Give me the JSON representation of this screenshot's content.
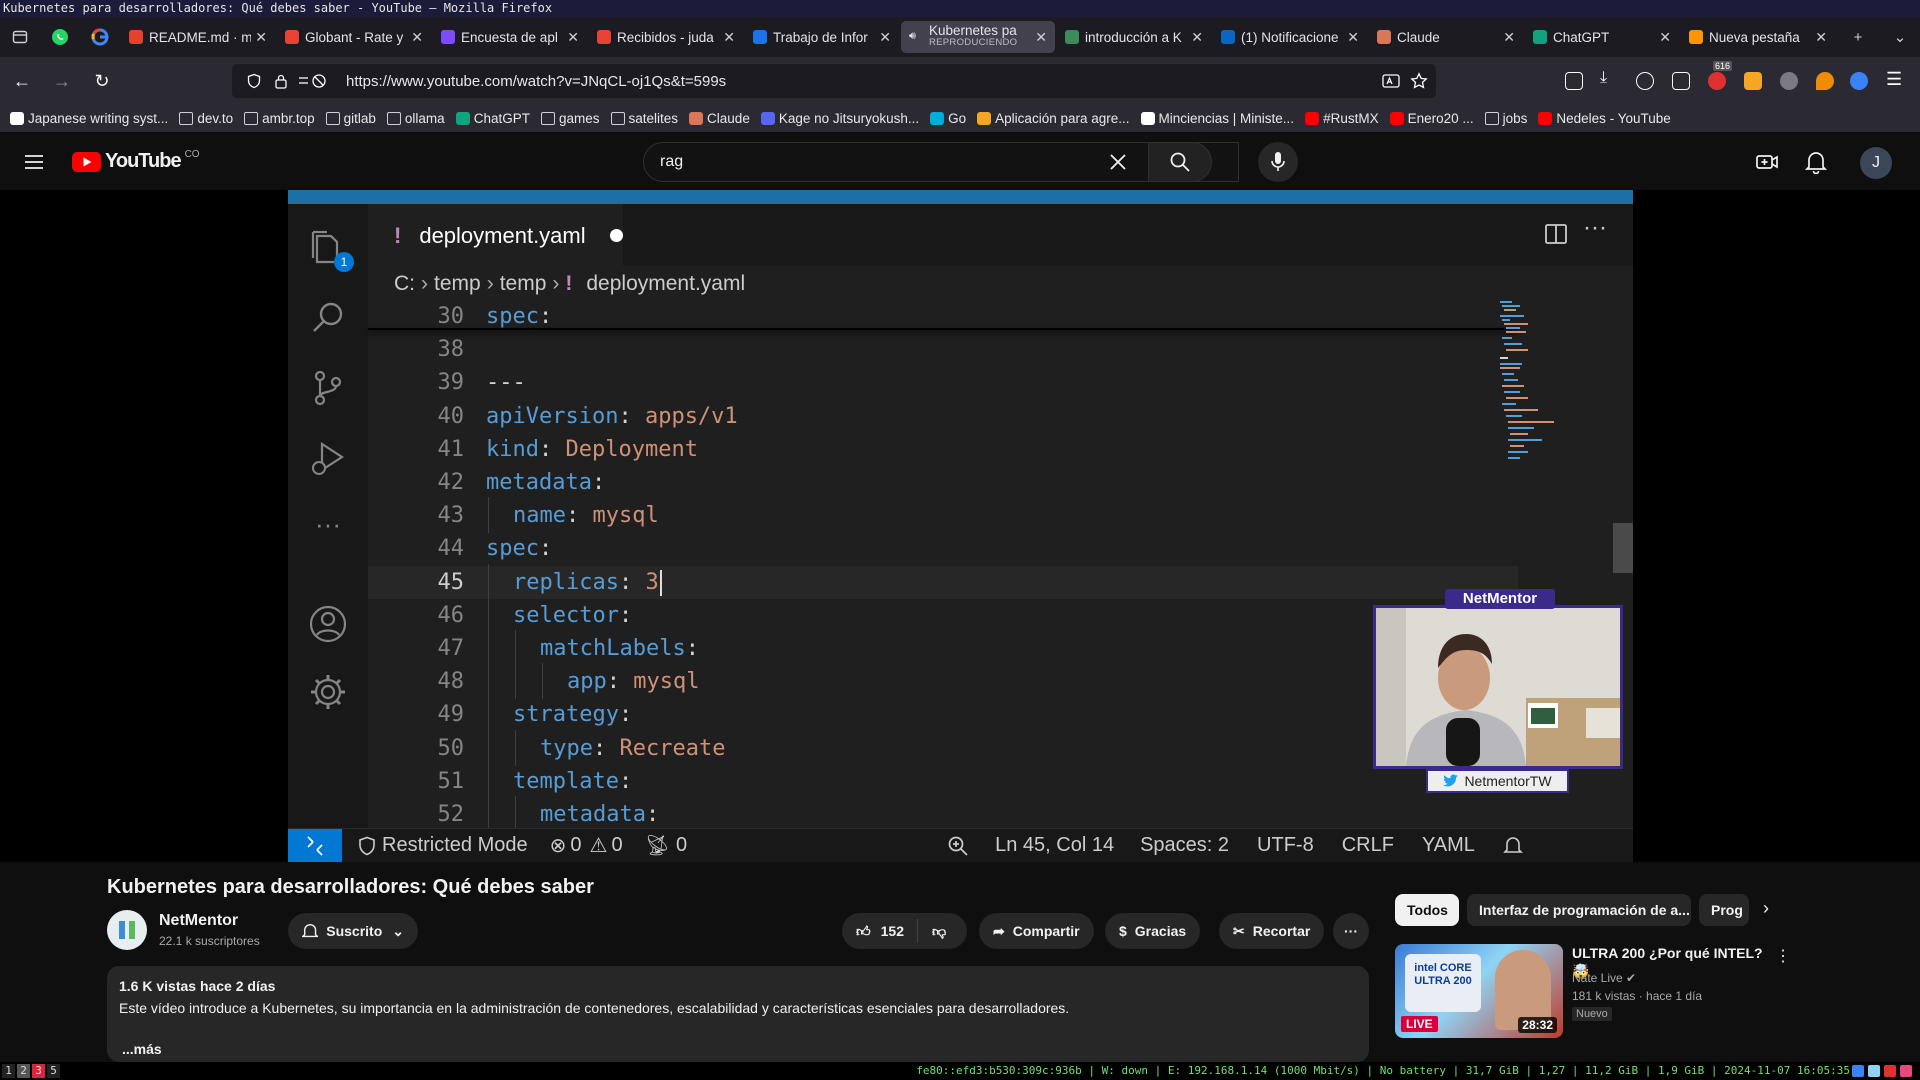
{
  "window": {
    "title": "Kubernetes para desarrolladores: Qué debes saber - YouTube — Mozilla Firefox"
  },
  "tabs": [
    {
      "title": "README.md · ma",
      "color": "#e2432a"
    },
    {
      "title": "Globant - Rate y",
      "color": "#ea4335"
    },
    {
      "title": "Encuesta de apl",
      "color": "#7c4dff"
    },
    {
      "title": "Recibidos - juda",
      "color": "#ea4335"
    },
    {
      "title": "Trabajo de Infor",
      "color": "#1a73e8"
    },
    {
      "title": "Kubernetes pa",
      "sub": "REPRODUCIENDO",
      "color": "#cccccc",
      "active": true
    },
    {
      "title": "introducción a K",
      "color": "#3c8b5b"
    },
    {
      "title": "(1) Notificacione",
      "color": "#0a66c2"
    },
    {
      "title": "Claude",
      "color": "#d97757"
    },
    {
      "title": "ChatGPT",
      "color": "#10a37f"
    },
    {
      "title": "Nueva pestaña",
      "color": "#ff9500"
    }
  ],
  "nav": {
    "url": "https://www.youtube.com/watch?v=JNqCL-oj1Qs&t=599s",
    "badge_count": "616"
  },
  "bookmarks": [
    {
      "label": "Japanese writing syst...",
      "fav": true,
      "color": "#ffffff"
    },
    {
      "label": "dev.to",
      "fav": false
    },
    {
      "label": "ambr.top",
      "fav": false
    },
    {
      "label": "gitlab",
      "fav": false
    },
    {
      "label": "ollama",
      "fav": false
    },
    {
      "label": "ChatGPT",
      "fav": true,
      "color": "#10a37f"
    },
    {
      "label": "games",
      "fav": false
    },
    {
      "label": "satelites",
      "fav": false
    },
    {
      "label": "Claude",
      "fav": true,
      "color": "#d97757"
    },
    {
      "label": "Kage no Jitsuryokush...",
      "fav": true,
      "color": "#5865f2"
    },
    {
      "label": "Go",
      "fav": true,
      "color": "#00add8"
    },
    {
      "label": "Aplicación para agre...",
      "fav": true,
      "color": "#f5a623"
    },
    {
      "label": "Minciencias | Ministe...",
      "fav": true,
      "color": "#ffffff"
    },
    {
      "label": "#RustMX",
      "fav": true,
      "color": "#ff0000"
    },
    {
      "label": "Enero20 ...",
      "fav": true,
      "color": "#ff0000"
    },
    {
      "label": "jobs",
      "fav": false
    },
    {
      "label": "Nedeles - YouTube",
      "fav": true,
      "color": "#ff0000"
    }
  ],
  "youtube": {
    "logo_text": "YouTube",
    "country": "CO",
    "search_value": "rag",
    "avatar_letter": "J"
  },
  "vscode": {
    "tab_name": "deployment.yaml",
    "breadcrumb": [
      "C:",
      "temp",
      "temp",
      "deployment.yaml"
    ],
    "lines": [
      {
        "n": "30",
        "indent": 0,
        "key": "spec",
        "sep": ":",
        "val": ""
      },
      {
        "n": "38",
        "indent": 0,
        "key": "",
        "sep": "",
        "val": ""
      },
      {
        "n": "39",
        "indent": 0,
        "key": "",
        "sep": "---",
        "val": ""
      },
      {
        "n": "40",
        "indent": 0,
        "key": "apiVersion",
        "sep": ": ",
        "val": "apps/v1"
      },
      {
        "n": "41",
        "indent": 0,
        "key": "kind",
        "sep": ": ",
        "val": "Deployment"
      },
      {
        "n": "42",
        "indent": 0,
        "key": "metadata",
        "sep": ":",
        "val": ""
      },
      {
        "n": "43",
        "indent": 1,
        "key": "name",
        "sep": ": ",
        "val": "mysql"
      },
      {
        "n": "44",
        "indent": 0,
        "key": "spec",
        "sep": ":",
        "val": ""
      },
      {
        "n": "45",
        "indent": 1,
        "key": "replicas",
        "sep": ": ",
        "val": "3",
        "current": true
      },
      {
        "n": "46",
        "indent": 1,
        "key": "selector",
        "sep": ":",
        "val": ""
      },
      {
        "n": "47",
        "indent": 2,
        "key": "matchLabels",
        "sep": ":",
        "val": ""
      },
      {
        "n": "48",
        "indent": 3,
        "key": "app",
        "sep": ": ",
        "val": "mysql"
      },
      {
        "n": "49",
        "indent": 1,
        "key": "strategy",
        "sep": ":",
        "val": ""
      },
      {
        "n": "50",
        "indent": 2,
        "key": "type",
        "sep": ": ",
        "val": "Recreate"
      },
      {
        "n": "51",
        "indent": 1,
        "key": "template",
        "sep": ":",
        "val": ""
      },
      {
        "n": "52",
        "indent": 2,
        "key": "metadata",
        "sep": ":",
        "val": ""
      }
    ],
    "status": {
      "restricted": "Restricted Mode",
      "errors": "0",
      "warnings": "0",
      "ports": "0",
      "position": "Ln 45, Col 14",
      "spaces": "Spaces: 2",
      "encoding": "UTF-8",
      "eol": "CRLF",
      "language": "YAML"
    }
  },
  "webcam": {
    "name": "NetMentor",
    "twitter": "NetmentorTW"
  },
  "video": {
    "title": "Kubernetes para desarrolladores: Qué debes saber",
    "channel": "NetMentor",
    "subscribers": "22.1 k suscriptores",
    "subscribed_label": "Suscrito",
    "likes": "152",
    "share": "Compartir",
    "thanks": "Gracias",
    "clip": "Recortar",
    "views": "1.6 K vistas  hace 2 días",
    "description": "Este vídeo introduce a Kubernetes, su importancia en la administración de contenedores, escalabilidad y características esenciales para desarrolladores.",
    "more": "...más"
  },
  "chips": [
    "Todos",
    "Interfaz de programación de a...",
    "Prog"
  ],
  "recommendation": {
    "title": "ULTRA 200 ¿Por qué INTEL? 🤯",
    "channel": "Nate Live",
    "meta": "181 k vistas · hace 1 día",
    "badge": "Nuevo",
    "duration": "28:32",
    "live_label": "LIVE",
    "thumb_text": "intel CORE ULTRA 200"
  },
  "system_bar": {
    "workspaces": [
      "1",
      "2",
      "3",
      "5"
    ],
    "status": "fe80::efd3:b530:309c:936b | W: down | E: 192.168.1.14 (1000 Mbit/s) | No battery | 31,7 GiB | 1,27 | 11,2 GiB | 1,9 GiB | 2024-11-07 16:05:35"
  }
}
